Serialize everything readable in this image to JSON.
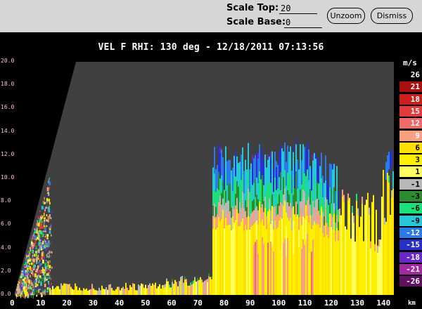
{
  "toolbar": {
    "scale_top_label": "Scale Top:",
    "scale_top_value": "20",
    "scale_base_label": "Scale Base:",
    "scale_base_value": "0",
    "unzoom_label": "Unzoom",
    "dismiss_label": "Dismiss"
  },
  "plot": {
    "title": "VEL F  RHI: 130 deg  -  12/18/2011 07:13:56",
    "x_axis_unit": "km",
    "x_ticks": [
      "0",
      "10",
      "20",
      "30",
      "40",
      "50",
      "60",
      "70",
      "80",
      "90",
      "100",
      "110",
      "120",
      "130",
      "140"
    ],
    "y_ticks": [
      "0.0",
      "2.0",
      "4.0",
      "6.0",
      "8.0",
      "10.0",
      "12.0",
      "14.0",
      "16.0",
      "18.0",
      "20.0"
    ],
    "x_range": [
      0,
      145
    ],
    "y_range": [
      0,
      20
    ]
  },
  "legend": {
    "unit": "m/s",
    "entries": [
      {
        "label": "26",
        "color": "#000000",
        "text": "#ffffff"
      },
      {
        "label": "21",
        "color": "#aa1010",
        "text": "#ffffff"
      },
      {
        "label": "18",
        "color": "#cc1e1e",
        "text": "#ffffff"
      },
      {
        "label": "15",
        "color": "#e33a3a",
        "text": "#ffffff"
      },
      {
        "label": "12",
        "color": "#f06a6a",
        "text": "#ffffff"
      },
      {
        "label": "9",
        "color": "#f8a080",
        "text": "#ffffff"
      },
      {
        "label": "6",
        "color": "#fde000",
        "text": "#000000"
      },
      {
        "label": "3",
        "color": "#fff000",
        "text": "#000000"
      },
      {
        "label": "1",
        "color": "#ffff60",
        "text": "#000000"
      },
      {
        "label": "-1",
        "color": "#b8b8b8",
        "text": "#000000"
      },
      {
        "label": "-3",
        "color": "#2e8a2e",
        "text": "#000000"
      },
      {
        "label": "-6",
        "color": "#1ce07a",
        "text": "#000000"
      },
      {
        "label": "-9",
        "color": "#24c8d8",
        "text": "#000000"
      },
      {
        "label": "-12",
        "color": "#2a7ae8",
        "text": "#ffffff"
      },
      {
        "label": "-15",
        "color": "#2830c8",
        "text": "#ffffff"
      },
      {
        "label": "-18",
        "color": "#6a28c8",
        "text": "#ffffff"
      },
      {
        "label": "-21",
        "color": "#a02aa0",
        "text": "#ffffff"
      },
      {
        "label": "-26",
        "color": "#601060",
        "text": "#ffffff"
      }
    ]
  }
}
